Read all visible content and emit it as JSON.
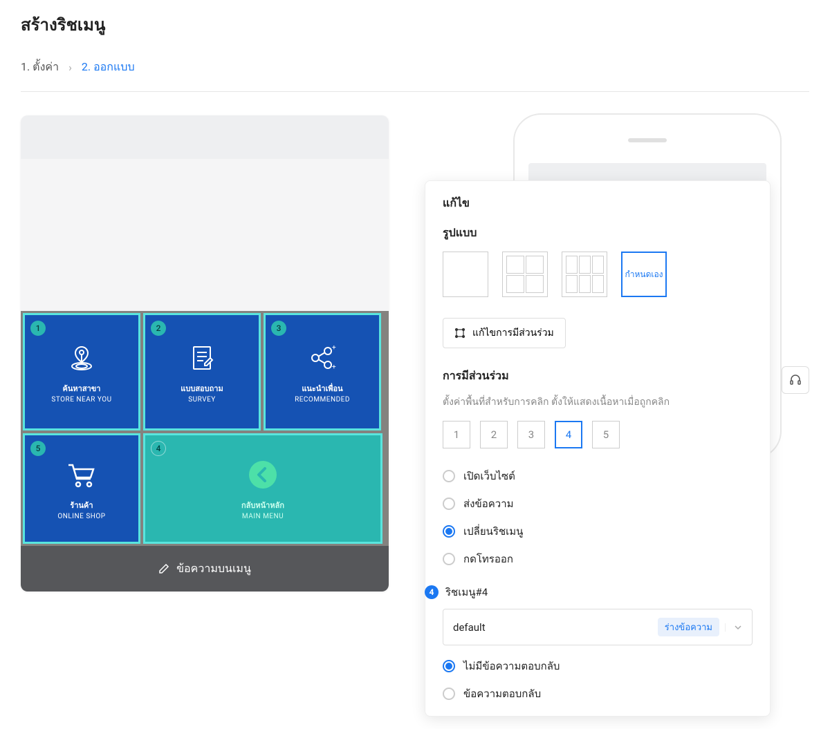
{
  "page_title": "สร้างริชเมนู",
  "breadcrumb": {
    "step1": "1. ตั้งค่า",
    "sep": "›",
    "step2": "2. ออกแบบ"
  },
  "rich_menu": {
    "cells": [
      {
        "n": "1",
        "th": "ค้นหาสาขา",
        "en": "STORE NEAR YOU"
      },
      {
        "n": "2",
        "th": "แบบสอบถาม",
        "en": "SURVEY"
      },
      {
        "n": "3",
        "th": "แนะนำเพื่อน",
        "en": "RECOMMENDED"
      },
      {
        "n": "5",
        "th": "ร้านค้า",
        "en": "ONLINE SHOP"
      },
      {
        "n": "4",
        "th": "กลับหน้าหลัก",
        "en": "MAIN MENU"
      }
    ],
    "footer": "ข้อความบนเมนู"
  },
  "edit": {
    "title": "แก้ไข",
    "template_label": "รูปแบบ",
    "custom": "กำหนดเอง",
    "edit_interaction_btn": "แก้ไขการมีส่วนร่วม",
    "interaction_label": "การมีส่วนร่วม",
    "interaction_desc": "ตั้งค่าพื้นที่สำหรับการคลิก ตั้งให้แสดงเนื้อหาเมื่อถูกคลิก",
    "slots": [
      "1",
      "2",
      "3",
      "4",
      "5"
    ],
    "selected_slot": "4",
    "actions": {
      "open_url": "เปิดเว็บไซต์",
      "send_msg": "ส่งข้อความ",
      "switch_rm": "เปลี่ยนริชเมนู",
      "call": "กดโทรออก"
    },
    "selected_action": "switch_rm",
    "step4_label": "ริชเมนู#4",
    "select_value": "default",
    "select_tag": "ร่างข้อความ",
    "reply": {
      "none": "ไม่มีข้อความตอบกลับ",
      "has": "ข้อความตอบกลับ"
    },
    "selected_reply": "none"
  }
}
